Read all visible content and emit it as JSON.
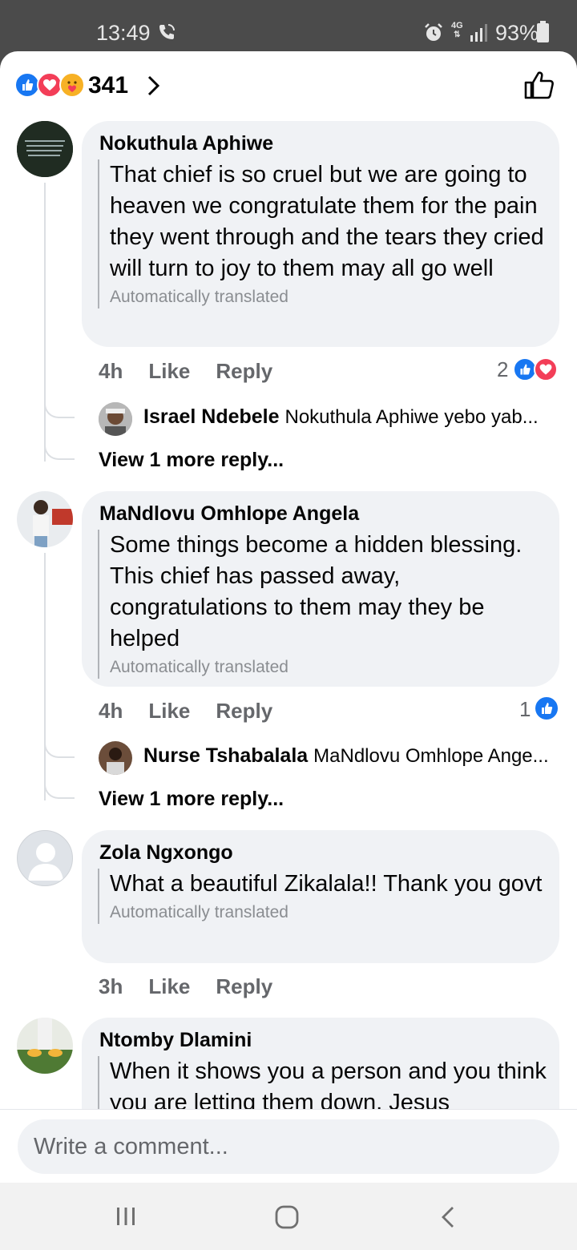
{
  "status_bar": {
    "time": "13:49",
    "network": "4G",
    "battery": "93%"
  },
  "reactions": {
    "count": "341"
  },
  "comments": [
    {
      "author": "Nokuthula Aphiwe",
      "text": "That chief is so cruel but we are going to heaven we congratulate them for the pain they went through and the tears they cried will turn to joy to them may all go well",
      "translated": "Automatically translated",
      "age": "4h",
      "like": "Like",
      "reply": "Reply",
      "reaction_count": "2",
      "reply_preview": {
        "author": "Israel Ndebele",
        "text": "Nokuthula Aphiwe yebo yab..."
      },
      "more_replies": "View 1 more reply..."
    },
    {
      "author": "MaNdlovu Omhlope Angela",
      "text": "Some things become a hidden blessing. This chief has passed away, congratulations to them may they be helped",
      "translated": "Automatically translated",
      "age": "4h",
      "like": "Like",
      "reply": "Reply",
      "reaction_count": "1",
      "reply_preview": {
        "author": "Nurse Tshabalala",
        "text": "MaNdlovu Omhlope Ange..."
      },
      "more_replies": "View 1 more reply..."
    },
    {
      "author": "Zola Ngxongo",
      "text": "What a beautiful Zikalala!! Thank you govt",
      "translated": "Automatically translated",
      "age": "3h",
      "like": "Like",
      "reply": "Reply"
    },
    {
      "author": "Ntomby Dlamini",
      "text": "When it shows you a person and you think you are letting them down, Jesus"
    }
  ],
  "composer": {
    "placeholder": "Write a comment..."
  },
  "colors": {
    "like_blue": "#1877f2",
    "love_red": "#f33e58",
    "care_yellow": "#f7b125",
    "bubble_bg": "#f0f2f5"
  }
}
